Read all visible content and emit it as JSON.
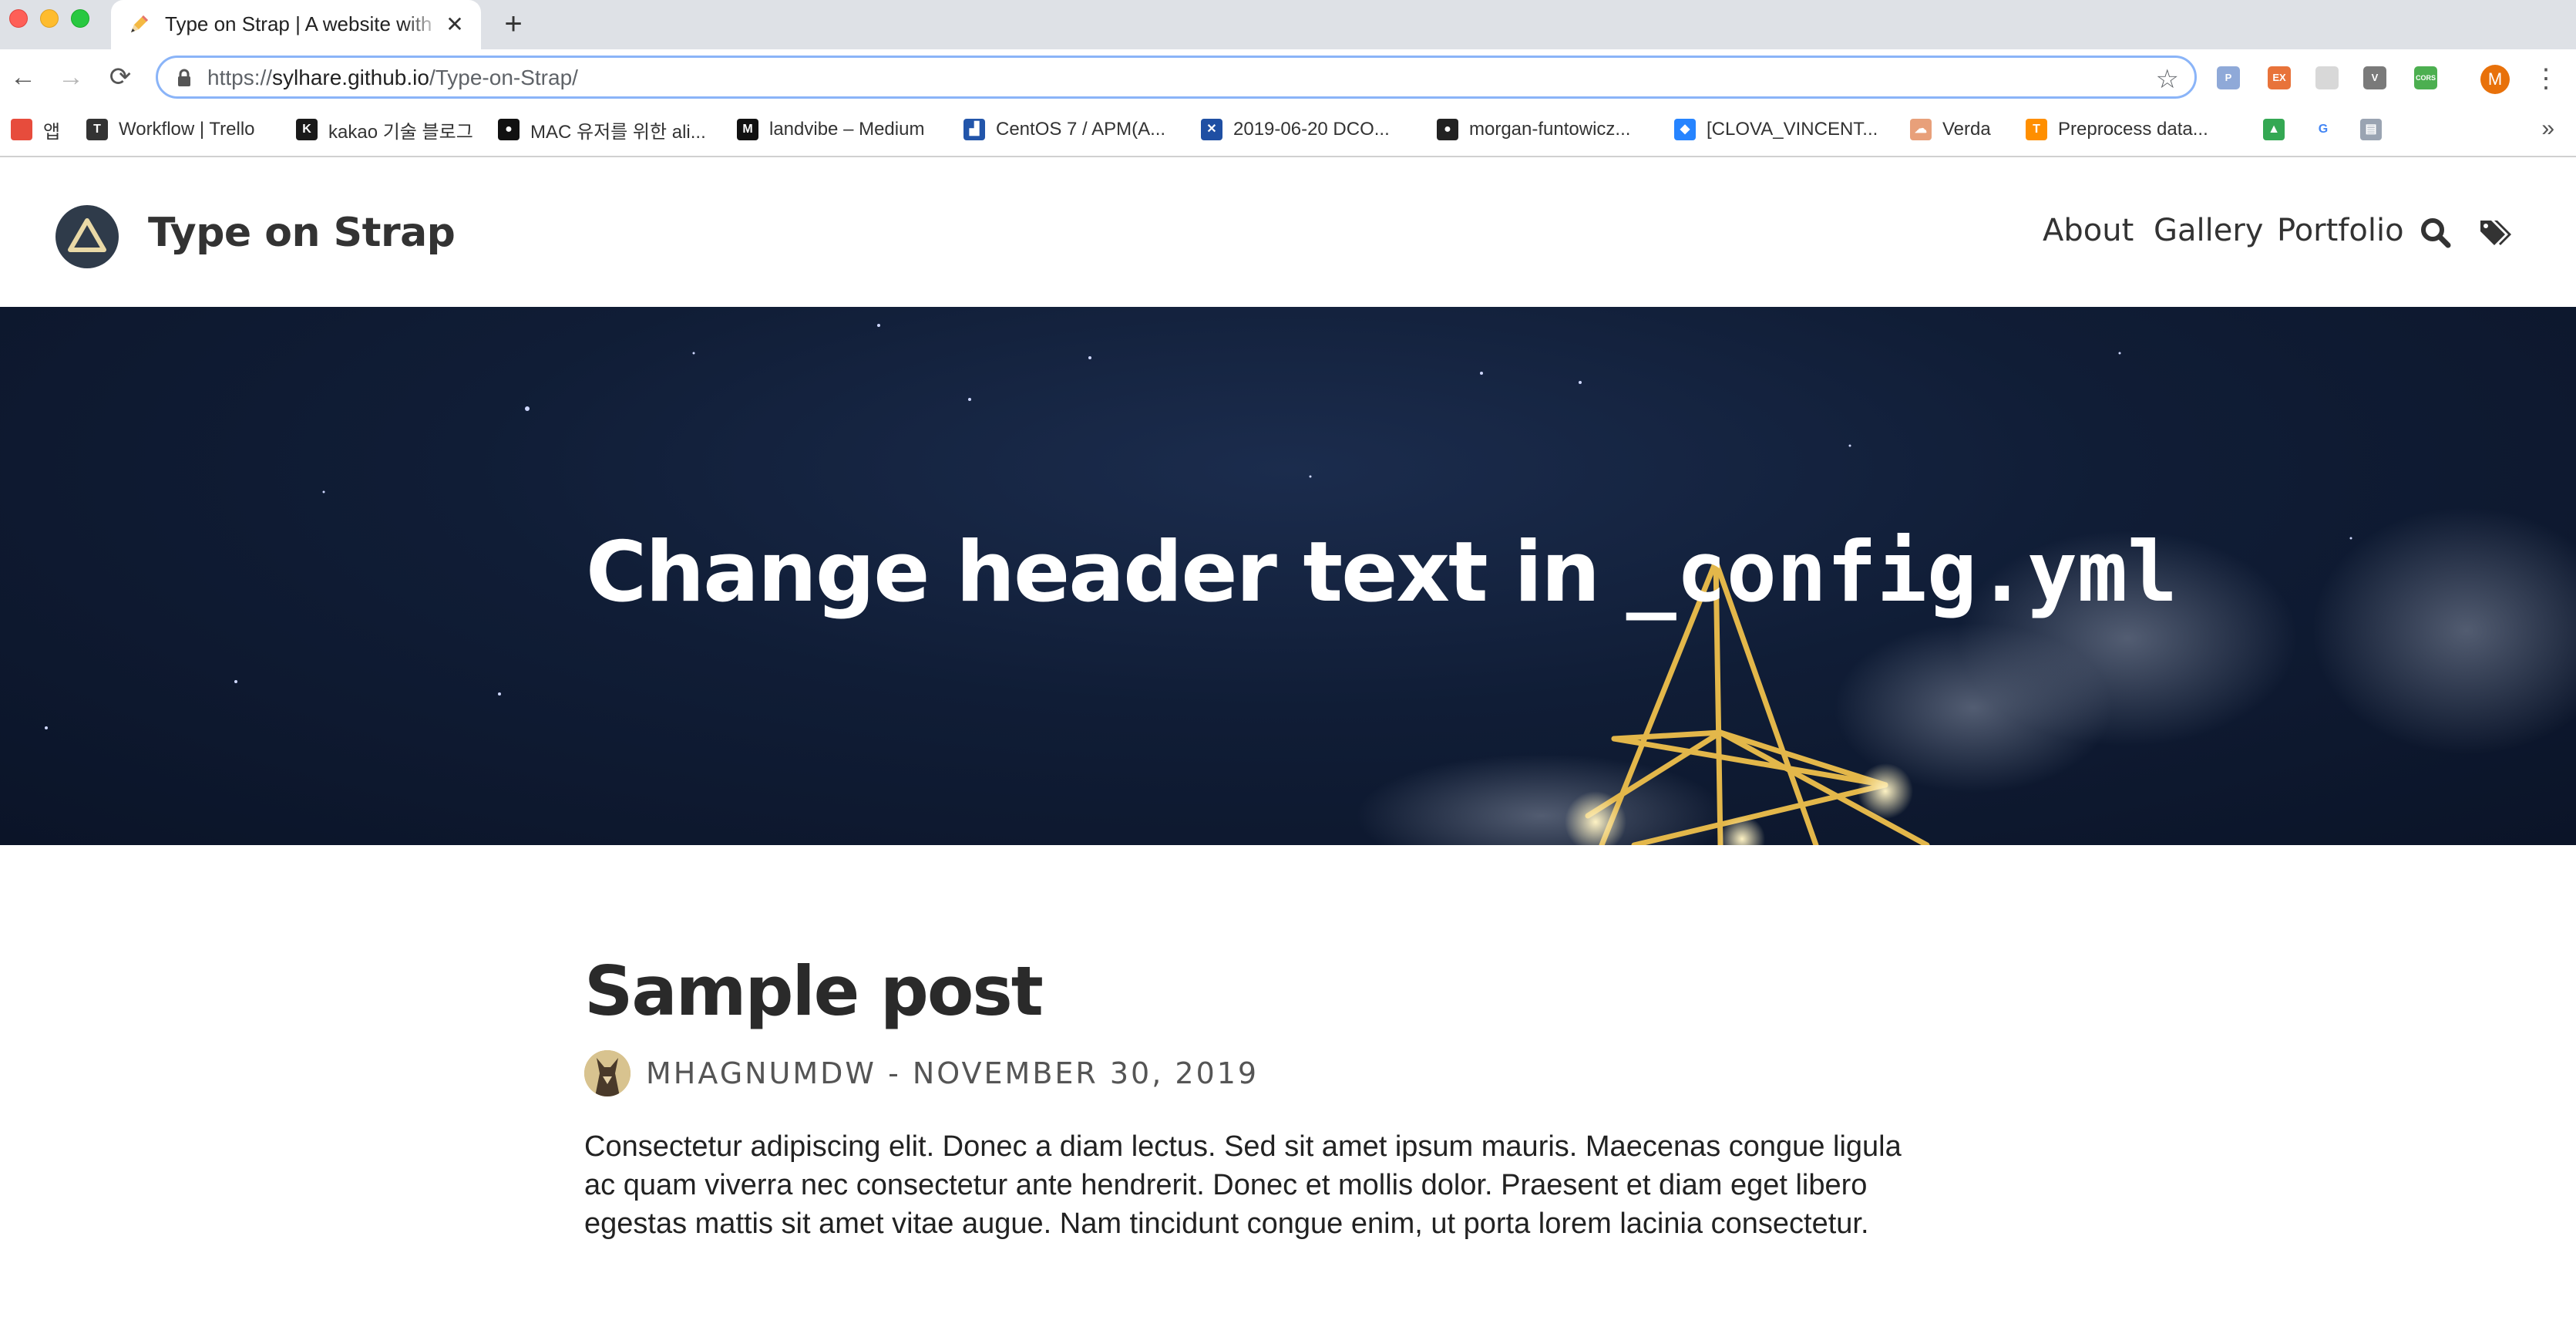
{
  "browser": {
    "tab": {
      "title": "Type on Strap | A website with",
      "close_glyph": "✕",
      "favicon": "pencil-icon"
    },
    "new_tab_glyph": "+",
    "toolbar": {
      "back_glyph": "←",
      "forward_glyph": "→",
      "reload_glyph": "⟳",
      "url_scheme": "https://",
      "url_host": "sylhare.github.io",
      "url_path": "/Type-on-Strap/",
      "star_glyph": "☆",
      "profile_initial": "M",
      "menu_glyph": "⋮",
      "extensions": [
        {
          "name": "paypal-extension-icon",
          "label": "P",
          "color": "#8fa9d8"
        },
        {
          "name": "ex-extension-icon",
          "label": "EX",
          "color": "#e8733a"
        },
        {
          "name": "grid-extension-icon",
          "label": "",
          "color": "#d8d8d8"
        },
        {
          "name": "vue-extension-icon",
          "label": "V",
          "color": "#7a7a7a"
        },
        {
          "name": "cors-extension-icon",
          "label": "CORS",
          "color": "#4caf50"
        }
      ]
    },
    "bookmarks": [
      {
        "label": "앱",
        "icon": "apps-grid-icon",
        "color": "#e74c3c",
        "mark": ""
      },
      {
        "label": "Workflow | Trello",
        "icon": "trello-icon",
        "color": "#333333",
        "mark": "T"
      },
      {
        "label": "kakao 기술 블로그",
        "icon": "kakao-icon",
        "color": "#1a1a1a",
        "mark": "K"
      },
      {
        "label": "MAC 유저를 위한 ali...",
        "icon": "mac-icon",
        "color": "#111111",
        "mark": "●"
      },
      {
        "label": "landvibe – Medium",
        "icon": "medium-icon",
        "color": "#111111",
        "mark": "M"
      },
      {
        "label": "CentOS 7 / APM(A...",
        "icon": "bars-icon",
        "color": "#2255aa",
        "mark": "▟"
      },
      {
        "label": "2019-06-20 DCO...",
        "icon": "confluence-icon",
        "color": "#1f4fa3",
        "mark": "✕"
      },
      {
        "label": "morgan-funtowicz...",
        "icon": "github-icon",
        "color": "#222222",
        "mark": "●"
      },
      {
        "label": "[CLOVA_VINCENT...",
        "icon": "jira-icon",
        "color": "#2684ff",
        "mark": "◆"
      },
      {
        "label": "Verda",
        "icon": "verda-icon",
        "color": "#e8a07a",
        "mark": "☁"
      },
      {
        "label": "Preprocess data...",
        "icon": "tensorflow-icon",
        "color": "#ff8f00",
        "mark": "T"
      },
      {
        "label": "",
        "icon": "google-drive-icon",
        "color": "#34a853",
        "mark": "▲"
      },
      {
        "label": "",
        "icon": "google-icon",
        "color": "#ffffff",
        "mark": "G"
      },
      {
        "label": "",
        "icon": "doc-icon",
        "color": "#9aa4b2",
        "mark": "▤"
      }
    ],
    "bookmarks_more": "»"
  },
  "site": {
    "title": "Type on Strap",
    "nav": [
      "About",
      "Gallery",
      "Portfolio"
    ],
    "search_icon": "search-icon",
    "tags_icon": "tags-icon"
  },
  "hero": {
    "title_text": "Change header text in ",
    "title_code": "_config.yml"
  },
  "post": {
    "title": "Sample post",
    "meta": "MHAGNUMDW - NOVEMBER 30, 2019",
    "excerpt": "Consectetur adipiscing elit. Donec a diam lectus. Sed sit amet ipsum mauris. Maecenas congue ligula ac quam viverra nec consectetur ante hendrerit. Donec et mollis dolor. Praesent et diam eget libero egestas mattis sit amet vitae augue. Nam tincidunt congue enim, ut porta lorem lacinia consectetur."
  }
}
